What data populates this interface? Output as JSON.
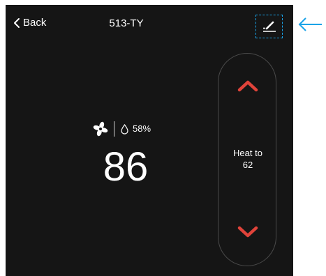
{
  "header": {
    "back_label": "Back",
    "device_name": "513-TY",
    "edit_icon": "pencil-icon"
  },
  "status": {
    "fan_icon": "fan-icon",
    "humidity_icon": "water-drop-icon",
    "humidity": "58%",
    "current_temperature": "86"
  },
  "setpoint": {
    "mode_label": "Heat to",
    "value": "62",
    "increase_icon": "chevron-up-icon",
    "decrease_icon": "chevron-down-icon"
  },
  "annotation": {
    "pointer_icon": "arrow-left-icon"
  },
  "colors": {
    "screen_background": "#151515",
    "text": "#ffffff",
    "accent_arrows": "#e0433a",
    "highlight": "#1aa3e8"
  }
}
